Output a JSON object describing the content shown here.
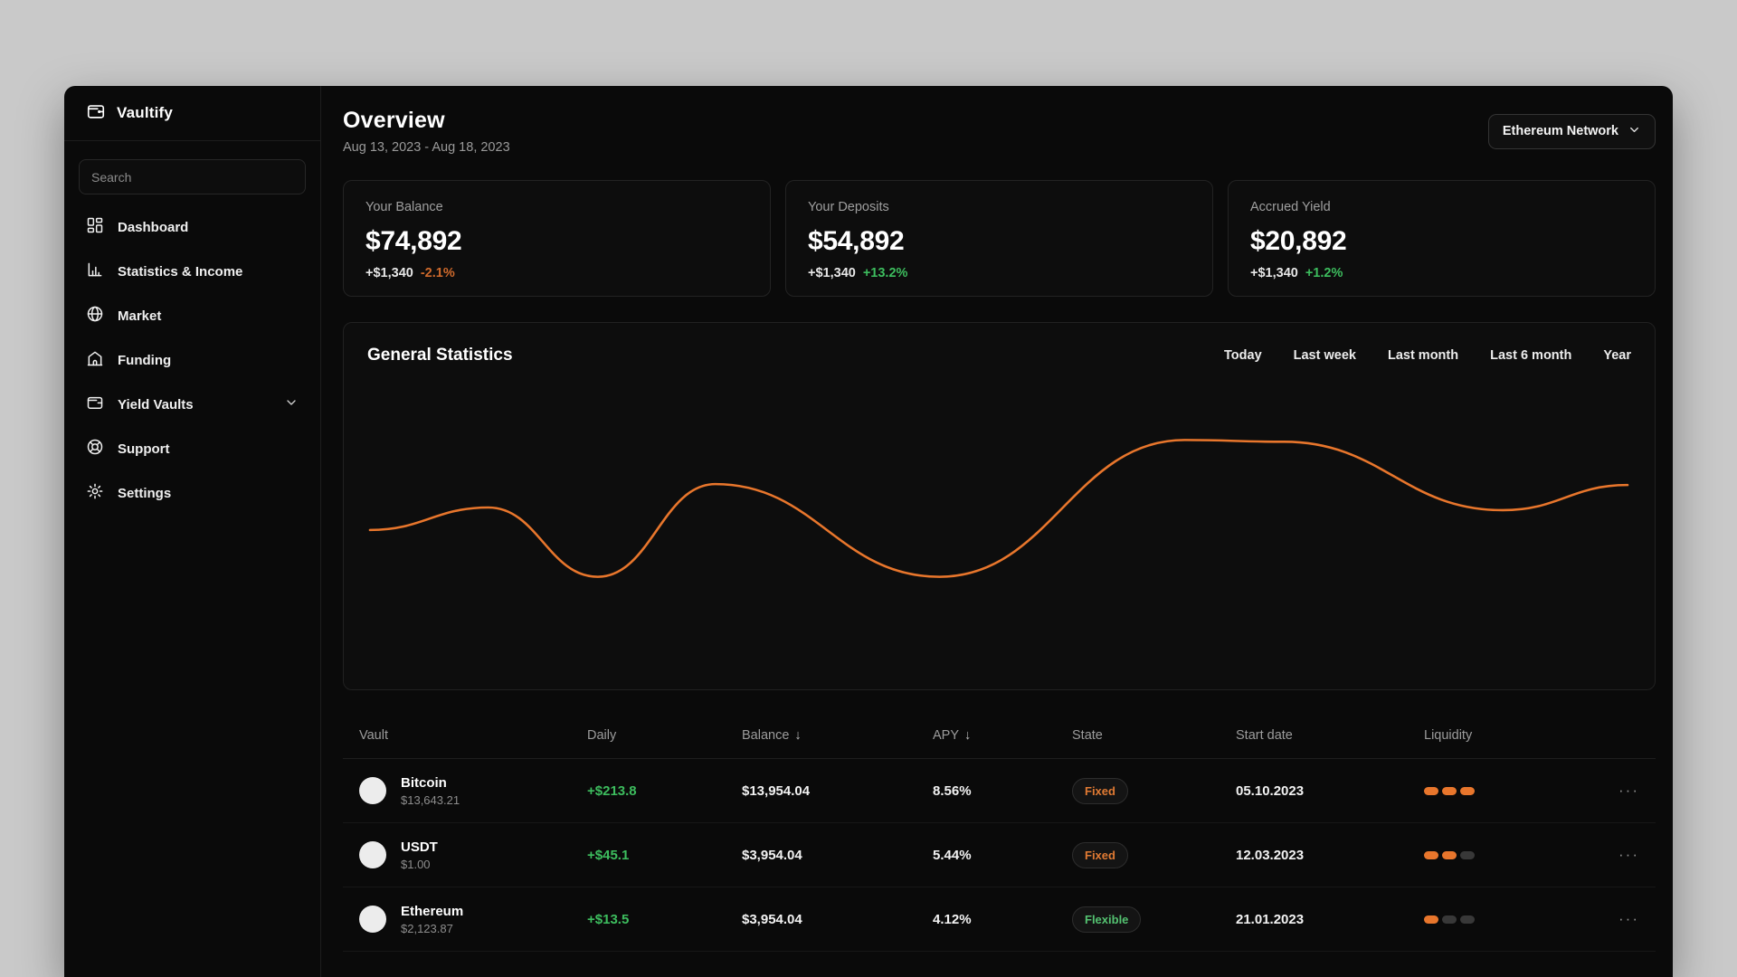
{
  "colors": {
    "page_bg": "#c9c9c9",
    "window_bg": "#0a0a0a",
    "accent_orange": "#e8762c",
    "positive_green": "#3dbd5e",
    "negative_orange": "#cf6a2c"
  },
  "sidebar": {
    "brand": "Vaultify",
    "search": {
      "placeholder": "Search"
    },
    "items": [
      {
        "label": "Dashboard"
      },
      {
        "label": "Statistics & Income"
      },
      {
        "label": "Market"
      },
      {
        "label": "Funding"
      },
      {
        "label": "Yield Vaults"
      },
      {
        "label": "Support"
      },
      {
        "label": "Settings"
      }
    ]
  },
  "header": {
    "title": "Overview",
    "date_range": "Aug 13, 2023 - Aug 18, 2023",
    "network": "Ethereum Network"
  },
  "stats": [
    {
      "label": "Your Balance",
      "value": "$74,892",
      "delta": "+$1,340",
      "pct": "-2.1%",
      "trend": "down"
    },
    {
      "label": "Your Deposits",
      "value": "$54,892",
      "delta": "+$1,340",
      "pct": "+13.2%",
      "trend": "up"
    },
    {
      "label": "Accrued Yield",
      "value": "$20,892",
      "delta": "+$1,340",
      "pct": "+1.2%",
      "trend": "up"
    }
  ],
  "chart": {
    "title": "General Statistics",
    "filters": [
      "Today",
      "Last week",
      "Last month",
      "Last 6 month",
      "Year"
    ]
  },
  "chart_data": {
    "type": "line",
    "title": "General Statistics",
    "xlabel": "",
    "ylabel": "",
    "grid": false,
    "legend": "none",
    "series": [
      {
        "name": "General Statistics",
        "color": "#e8762c",
        "points": [
          [
            29,
            230
          ],
          [
            160,
            205
          ],
          [
            281,
            282
          ],
          [
            411,
            179
          ],
          [
            659,
            282
          ],
          [
            930,
            130
          ],
          [
            1040,
            132
          ],
          [
            1282,
            208
          ],
          [
            1420,
            180
          ]
        ]
      }
    ],
    "note": "no visible axes or tick labels; points are curve coordinates in the 1450x407 card viewBox"
  },
  "table": {
    "headers": [
      "Vault",
      "Daily",
      "Balance",
      "APY",
      "State",
      "Start date",
      "Liquidity"
    ],
    "sort_arrow": "↓",
    "menu_icon": "···",
    "rows": [
      {
        "name": "Bitcoin",
        "price": "$13,643.21",
        "daily": "+$213.8",
        "balance": "$13,954.04",
        "apy": "8.56%",
        "state": "Fixed",
        "start_date": "05.10.2023",
        "liquidity": 3
      },
      {
        "name": "USDT",
        "price": "$1.00",
        "daily": "+$45.1",
        "balance": "$3,954.04",
        "apy": "5.44%",
        "state": "Fixed",
        "start_date": "12.03.2023",
        "liquidity": 2
      },
      {
        "name": "Ethereum",
        "price": "$2,123.87",
        "daily": "+$13.5",
        "balance": "$3,954.04",
        "apy": "4.12%",
        "state": "Flexible",
        "start_date": "21.01.2023",
        "liquidity": 1
      }
    ]
  }
}
